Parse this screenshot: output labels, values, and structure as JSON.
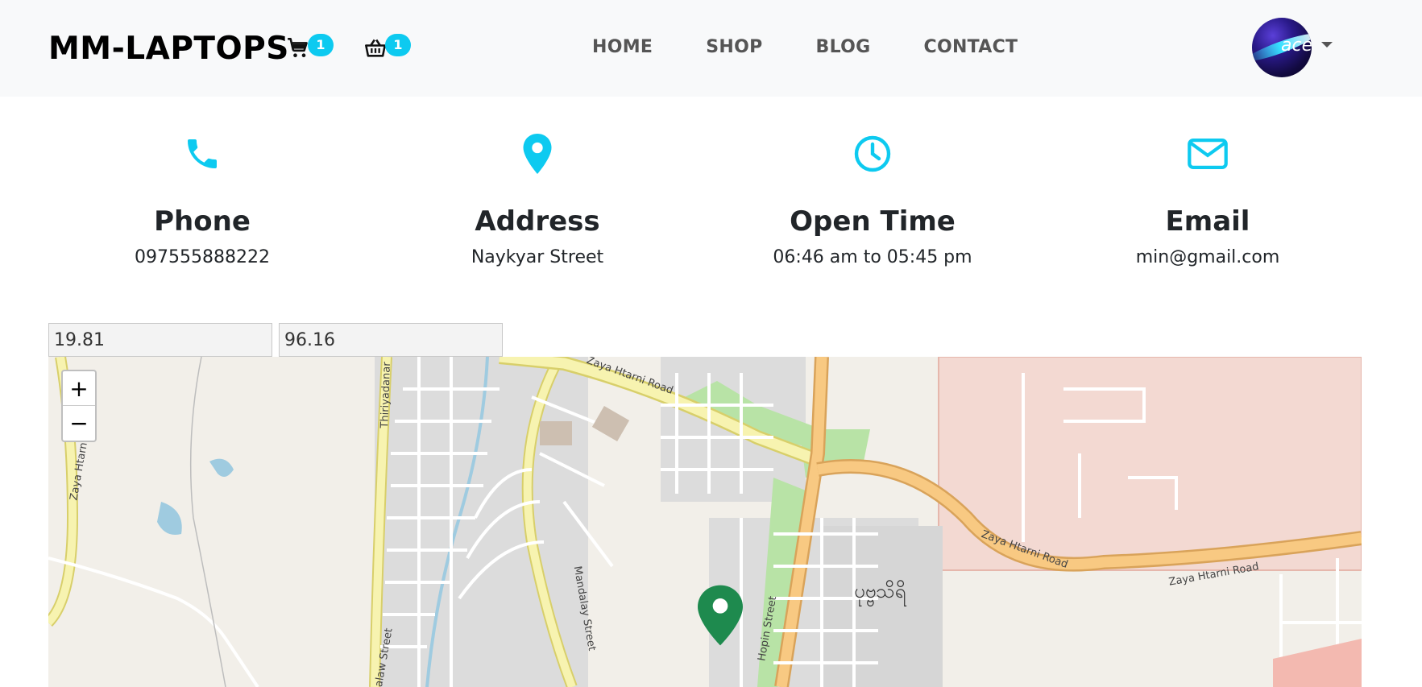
{
  "header": {
    "brand": "MM-LAPTOPS",
    "cart_count": "1",
    "basket_count": "1",
    "nav": [
      "HOME",
      "SHOP",
      "BLOG",
      "CONTACT"
    ],
    "avatar_text": "ace"
  },
  "contact_info": [
    {
      "icon": "phone-icon",
      "title": "Phone",
      "value": "097555888222"
    },
    {
      "icon": "location-pin-icon",
      "title": "Address",
      "value": "Naykyar Street"
    },
    {
      "icon": "clock-icon",
      "title": "Open Time",
      "value": "06:46 am to 05:45 pm"
    },
    {
      "icon": "envelope-icon",
      "title": "Email",
      "value": "min@gmail.com"
    }
  ],
  "coordinates": {
    "latitude": "19.81",
    "longitude": "96.16"
  },
  "map": {
    "zoom_in": "+",
    "zoom_out": "−",
    "labels": {
      "zaya_htarni_road_1": "Zaya Htarni Road",
      "zaya_htarni_road_2": "Zaya Htarni Road",
      "zaya_htarni_road_3": "Zaya Htarni Road",
      "zaya_htarni_road_left": "Zaya Htarni Road",
      "thiriyadanar": "Thiriyadanar",
      "mandalay_street": "Mandalay Street",
      "hopin_street": "Hopin Street",
      "salaw_street": "Salaw Street",
      "burmese_area": "ပုဗ္ဗသိရိ"
    },
    "marker_color": "#1e8a4e",
    "accent_color": "#0dcaf0"
  }
}
